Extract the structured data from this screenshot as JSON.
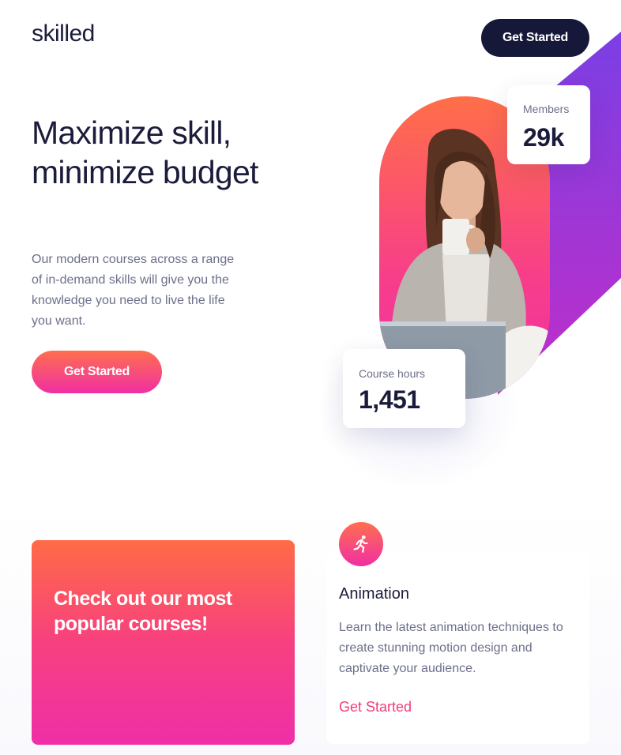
{
  "header": {
    "logo": "skilled",
    "cta_label": "Get Started"
  },
  "hero": {
    "title": "Maximize skill, minimize budget",
    "description": "Our modern courses across a range of in-demand skills will give you the knowledge you need to live the life you want.",
    "cta_label": "Get Started"
  },
  "stats": {
    "members_label": "Members",
    "members_value": "29k",
    "hours_label": "Course hours",
    "hours_value": "1,451"
  },
  "promo": {
    "text": "Check out our most popular courses!"
  },
  "course": {
    "icon": "running-person-icon",
    "title": "Animation",
    "description": "Learn the latest animation techniques to create stunning motion design and captivate your audience.",
    "link_label": "Get Started"
  },
  "colors": {
    "navy": "#161839",
    "gradient_start": "#ff6f4e",
    "gradient_end": "#f02fa3",
    "purple": "#7b3fe4",
    "link": "#f23d7e"
  }
}
